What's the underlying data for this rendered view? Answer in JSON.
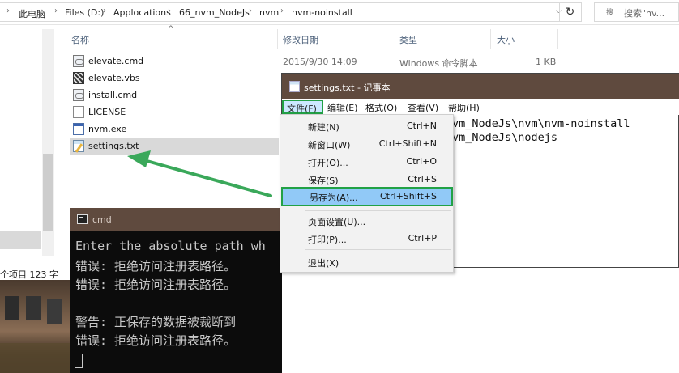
{
  "explorer": {
    "breadcrumb": [
      "此电脑",
      "Files (D:)",
      "Applocations",
      "66_nvm_NodeJs",
      "nvm",
      "nvm-noinstall"
    ],
    "search_placeholder": "搜索\"nv...",
    "columns": {
      "name": "名称",
      "modified": "修改日期",
      "type": "类型",
      "size": "大小"
    },
    "files": [
      {
        "name": "elevate.cmd",
        "icon": "cmd-file-icon",
        "modified": "2015/9/30 14:09",
        "type": "Windows 命令脚本",
        "size": "1 KB"
      },
      {
        "name": "elevate.vbs",
        "icon": "vbs-file-icon"
      },
      {
        "name": "install.cmd",
        "icon": "cmd-file-icon"
      },
      {
        "name": "LICENSE",
        "icon": "file-icon"
      },
      {
        "name": "nvm.exe",
        "icon": "exe-icon"
      },
      {
        "name": "settings.txt",
        "icon": "txt-file-icon",
        "selected": true
      }
    ],
    "status": "个项目   123 字"
  },
  "cmd": {
    "title": "cmd",
    "lines": [
      "Enter the absolute path wh",
      "错误: 拒绝访问注册表路径。",
      "错误: 拒绝访问注册表路径。",
      "",
      "警告: 正保存的数据被裁断到",
      "错误: 拒绝访问注册表路径。"
    ]
  },
  "notepad": {
    "title": "settings.txt - 记事本",
    "menus": [
      {
        "label": "文件(F)",
        "active": true
      },
      {
        "label": "编辑(E)"
      },
      {
        "label": "格式(O)"
      },
      {
        "label": "查看(V)"
      },
      {
        "label": "帮助(H)"
      }
    ],
    "content_lines": [
      "vm_NodeJs\\nvm\\nvm-noinstall",
      "vm_NodeJs\\nodejs"
    ]
  },
  "file_menu": [
    {
      "label": "新建(N)",
      "shortcut": "Ctrl+N"
    },
    {
      "label": "新窗口(W)",
      "shortcut": "Ctrl+Shift+N"
    },
    {
      "label": "打开(O)...",
      "shortcut": "Ctrl+O"
    },
    {
      "label": "保存(S)",
      "shortcut": "Ctrl+S"
    },
    {
      "label": "另存为(A)...",
      "shortcut": "Ctrl+Shift+S",
      "highlighted": true
    },
    {
      "label": "页面设置(U)...",
      "shortcut": ""
    },
    {
      "label": "打印(P)...",
      "shortcut": "Ctrl+P"
    },
    {
      "label": "退出(X)",
      "shortcut": ""
    }
  ],
  "colors": {
    "highlight_border": "#22a146",
    "arrow": "#3aa85a",
    "titlebar": "#5f4a3e"
  }
}
